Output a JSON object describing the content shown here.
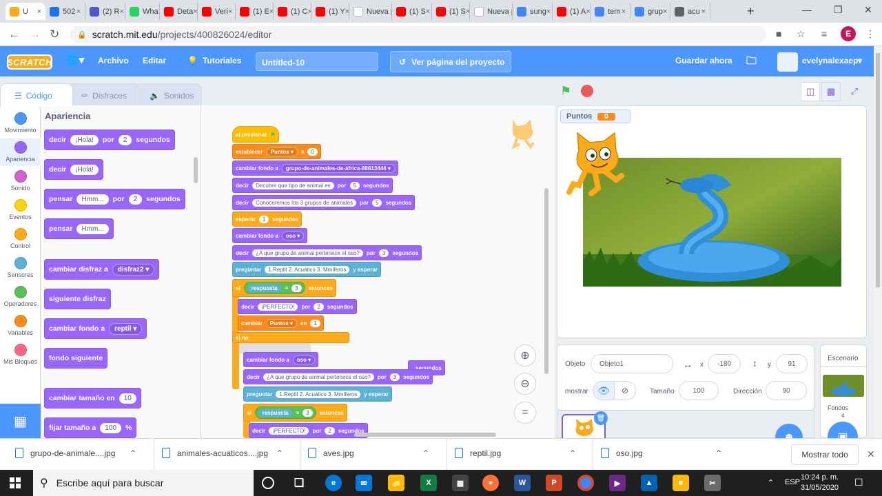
{
  "browser": {
    "tabs": [
      {
        "label": "U",
        "color": "#ffab19"
      },
      {
        "label": "502",
        "color": "#1a73e8"
      },
      {
        "label": "(2) R",
        "color": "#5059c9"
      },
      {
        "label": "Wha",
        "color": "#25d366"
      },
      {
        "label": "Deta",
        "color": "#ff0000"
      },
      {
        "label": "Veri",
        "color": "#ff0000"
      },
      {
        "label": "(1) E",
        "color": "#ff0000"
      },
      {
        "label": "(1) C",
        "color": "#ff0000"
      },
      {
        "label": "(1) Y",
        "color": "#ff0000"
      },
      {
        "label": "Nueva p",
        "color": "#ffffff"
      },
      {
        "label": "(1) S",
        "color": "#ff0000"
      },
      {
        "label": "(1) S",
        "color": "#ff0000"
      },
      {
        "label": "Nueva p",
        "color": "#ffffff"
      },
      {
        "label": "sung",
        "color": "#4285f4"
      },
      {
        "label": "(1) A",
        "color": "#ff0000"
      },
      {
        "label": "tem",
        "color": "#4285f4"
      },
      {
        "label": "grup",
        "color": "#4285f4"
      },
      {
        "label": "acu",
        "color": "#5f6368"
      }
    ],
    "new_tab": "+",
    "url_host": "scratch.mit.edu",
    "url_path": "/projects/400826024/editor",
    "profile_initial": "E"
  },
  "menubar": {
    "logo": "SCRATCH",
    "archivo": "Archivo",
    "editar": "Editar",
    "tutoriales": "Tutoriales",
    "project_title": "Untitled-10",
    "ver_pagina": "Ver página del proyecto",
    "guardar": "Guardar ahora",
    "username": "evelynalexaep"
  },
  "editor_tabs": {
    "codigo": "Código",
    "disfraces": "Disfraces",
    "sonidos": "Sonidos"
  },
  "categories": [
    {
      "label": "Movimiento",
      "color": "#4c97ff"
    },
    {
      "label": "Apariencia",
      "color": "#9966ff"
    },
    {
      "label": "Sonido",
      "color": "#cf63cf"
    },
    {
      "label": "Eventos",
      "color": "#ffd500"
    },
    {
      "label": "Control",
      "color": "#ffab19"
    },
    {
      "label": "Sensores",
      "color": "#5cb1d6"
    },
    {
      "label": "Operadores",
      "color": "#59c059"
    },
    {
      "label": "Variables",
      "color": "#ff8c1a"
    },
    {
      "label": "Mis Bloques",
      "color": "#ff6680"
    }
  ],
  "palette": {
    "title": "Apariencia",
    "b1": {
      "a": "decir",
      "p": "¡Hola!",
      "b": "por",
      "n": "2",
      "c": "segundos"
    },
    "b2": {
      "a": "decir",
      "p": "¡Hola!"
    },
    "b3": {
      "a": "pensar",
      "p": "Hmm...",
      "b": "por",
      "n": "2",
      "c": "segundos"
    },
    "b4": {
      "a": "pensar",
      "p": "Hmm..."
    },
    "b5": {
      "a": "cambiar disfraz a",
      "d": "disfraz2 ▾"
    },
    "b6": {
      "a": "siguiente disfraz"
    },
    "b7": {
      "a": "cambiar fondo a",
      "d": "reptil ▾"
    },
    "b8": {
      "a": "fondo siguiente"
    },
    "b9": {
      "a": "cambiar tamaño en",
      "n": "10"
    },
    "b10": {
      "a": "fijar tamaño a",
      "n": "100",
      "c": "%"
    }
  },
  "script": {
    "s1": "al presionar",
    "s2": {
      "a": "establecer",
      "d": "Puntos ▾",
      "b": "a",
      "n": "0"
    },
    "s3": {
      "a": "cambiar fondo a",
      "d": "grupo-de-animales-de-áfrica-88613444 ▾"
    },
    "s4": {
      "a": "decir",
      "p": "Decubre que tipo de animal es",
      "b": "por",
      "n": "5",
      "c": "segundos"
    },
    "s5": {
      "a": "decir",
      "p": "Conoceremos los 3 grupos de animales",
      "b": "por",
      "n": "5",
      "c": "segundos"
    },
    "s6": {
      "a": "esperar",
      "n": "1",
      "c": "segundos"
    },
    "s7": {
      "a": "cambiar fondo a",
      "d": "oso ▾"
    },
    "s8": {
      "a": "decir",
      "p": "¿A que grupo de animal pertenece el oso?",
      "b": "por",
      "n": "3",
      "c": "segundos"
    },
    "s9": {
      "a": "preguntar",
      "p": "1.Reptil 2. Acuático 3. Mmíferos",
      "c": "y esperar"
    },
    "s10": {
      "a": "si",
      "l": "respuesta",
      "eq": "=",
      "n": "3",
      "c": "entonces"
    },
    "s11": {
      "a": "decir",
      "p": "¡PERFECTO!",
      "b": "por",
      "n": "2",
      "c": "segundos"
    },
    "s12": {
      "a": "cambiar",
      "d": "Puntos ▾",
      "b": "en",
      "n": "1"
    },
    "s13": "si no",
    "d1": {
      "a": "cambiar fondo a",
      "d": "oso ▾"
    },
    "d1tail": "segundos",
    "d2": {
      "a": "decir",
      "p": "¿A que grupo de animal pertenece el oso?",
      "b": "por",
      "n": "3",
      "c": "segundos"
    },
    "d3": {
      "a": "preguntar",
      "p": "1.Reptil 2. Acuático 3. Mmíferos",
      "c": "y esperar"
    },
    "d4": {
      "a": "si",
      "l": "respuesta",
      "eq": "=",
      "n": "3",
      "c": "entonces"
    },
    "d5": {
      "a": "decir",
      "p": "¡PERFECTO!",
      "b": "por",
      "n": "2",
      "c": "segundos"
    }
  },
  "stage": {
    "monitor_label": "Puntos",
    "monitor_value": "0"
  },
  "sprite_info": {
    "objeto_label": "Objeto",
    "objeto_value": "Objeto1",
    "x_label": "x",
    "x_value": "-180",
    "y_label": "y",
    "y_value": "91",
    "mostrar_label": "mostrar",
    "tamano_label": "Tamaño",
    "tamano_value": "100",
    "direccion_label": "Dirección",
    "direccion_value": "90"
  },
  "stage_panel": {
    "title": "Escenario",
    "fondos_label": "Fondos",
    "fondos_count": "4"
  },
  "downloads": {
    "items": [
      "grupo-de-animale....jpg",
      "animales-acuaticos....jpg",
      "aves.jpg",
      "reptil.jpg",
      "oso.jpg"
    ],
    "show_all": "Mostrar todo"
  },
  "taskbar": {
    "search_placeholder": "Escribe aquí para buscar",
    "lang": "ESP",
    "time": "10:24 p. m.",
    "date": "31/05/2020"
  }
}
